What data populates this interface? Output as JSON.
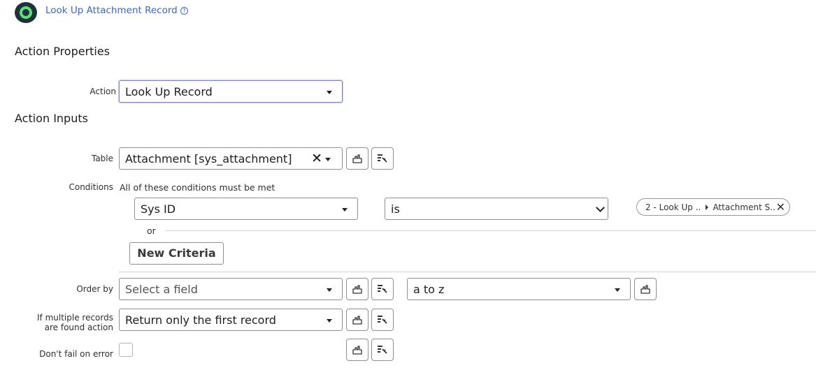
{
  "header": {
    "title": "Look Up Attachment Record",
    "help_icon": "question-circle-icon",
    "app_icon": "flow-designer-logo-icon"
  },
  "action_properties": {
    "heading": "Action Properties",
    "action": {
      "label": "Action",
      "value": "Look Up Record"
    }
  },
  "action_inputs": {
    "heading": "Action Inputs",
    "table": {
      "label": "Table",
      "value": "Attachment [sys_attachment]"
    },
    "conditions": {
      "label": "Conditions",
      "description": "All of these conditions must be met",
      "field": "Sys ID",
      "operator": "is",
      "data_pill": {
        "first": "2 - Look Up ...",
        "second": "Attachment S..."
      },
      "or_label": "or",
      "new_criteria_label": "New Criteria"
    },
    "order_by": {
      "label": "Order by",
      "field_placeholder": "Select a field",
      "direction": "a to z"
    },
    "multiple_records": {
      "label": "If multiple records are found action",
      "value": "Return only the first record"
    },
    "dont_fail": {
      "label": "Don't fail on error",
      "checked": false
    }
  },
  "icons": {
    "data_pill_picker": "data-pill-icon",
    "script_toggle": "script-icon"
  },
  "colors": {
    "link": "#3d64c6",
    "logo_ring": "#63d97b",
    "logo_bg": "#1c3338"
  }
}
